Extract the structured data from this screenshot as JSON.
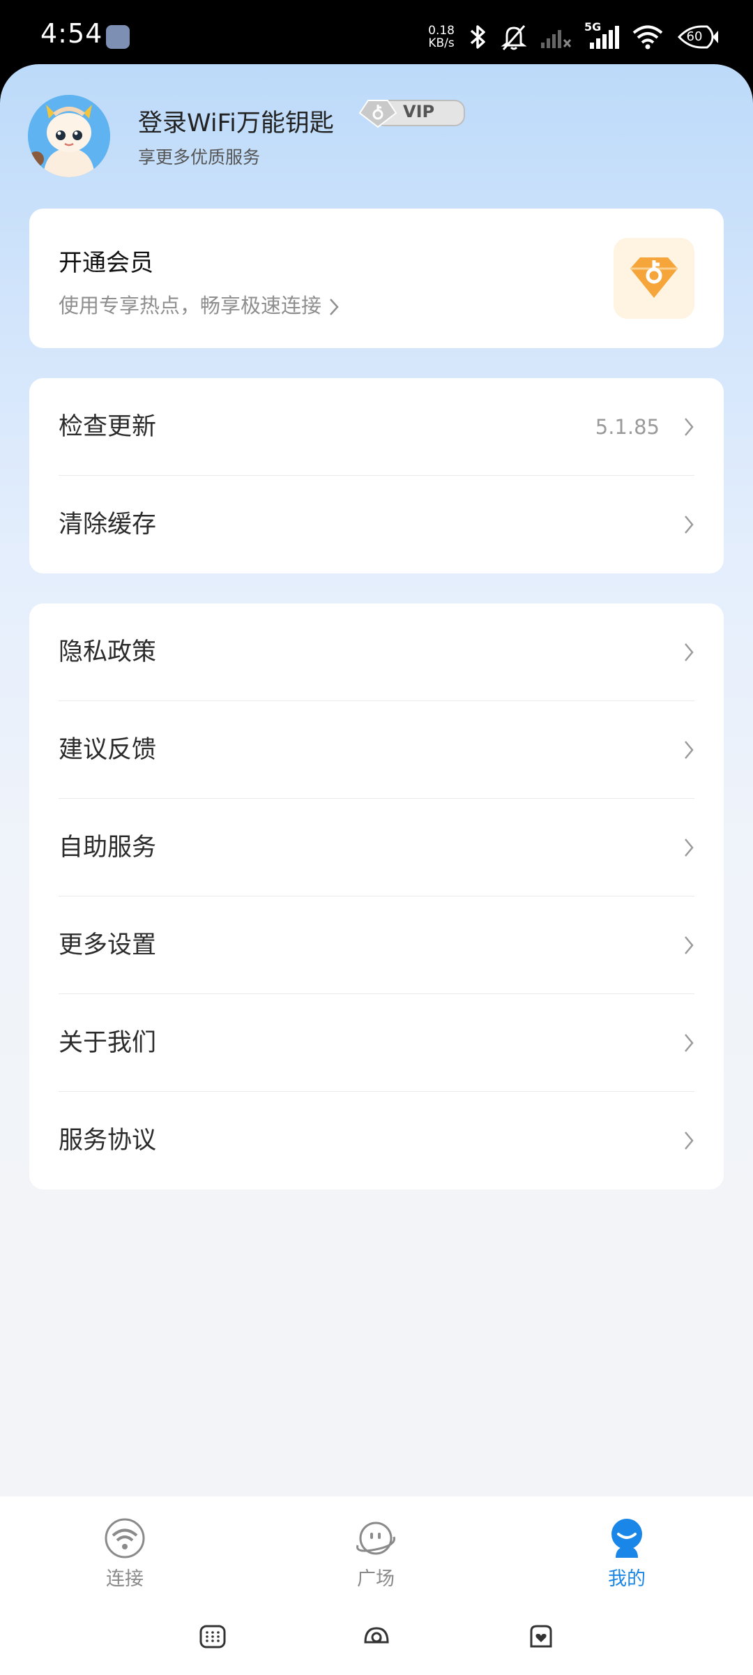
{
  "status_bar": {
    "time": "4:54",
    "net_speed_value": "0.18",
    "net_speed_unit": "KB/s",
    "network_label": "5G",
    "battery_level": "60",
    "icons": [
      "bluetooth-icon",
      "bell-off-icon",
      "signal-icon",
      "signal-5g-icon",
      "wifi-icon",
      "battery-icon"
    ]
  },
  "profile": {
    "title": "登录WiFi万能钥匙",
    "vip_badge": "VIP",
    "subtitle": "享更多优质服务"
  },
  "membership": {
    "title": "开通会员",
    "subtitle": "使用专享热点，畅享极速连接",
    "icon": "diamond-key-icon"
  },
  "update_section": {
    "items": [
      {
        "label": "检查更新",
        "value": "5.1.85"
      },
      {
        "label": "清除缓存",
        "value": ""
      }
    ]
  },
  "settings_section": {
    "items": [
      {
        "label": "隐私政策"
      },
      {
        "label": "建议反馈"
      },
      {
        "label": "自助服务"
      },
      {
        "label": "更多设置"
      },
      {
        "label": "关于我们"
      },
      {
        "label": "服务协议"
      }
    ]
  },
  "tabbar": {
    "tabs": [
      {
        "label": "连接",
        "icon": "wifi-icon",
        "active": false
      },
      {
        "label": "广场",
        "icon": "planet-face-icon",
        "active": false
      },
      {
        "label": "我的",
        "icon": "person-icon",
        "active": true
      }
    ]
  },
  "colors": {
    "accent": "#1a86e8",
    "background_top": "#bcdaf9",
    "background_bottom": "#f2f4f8",
    "member_icon_bg": "#fff3e1",
    "member_icon": "#f5a53a"
  }
}
